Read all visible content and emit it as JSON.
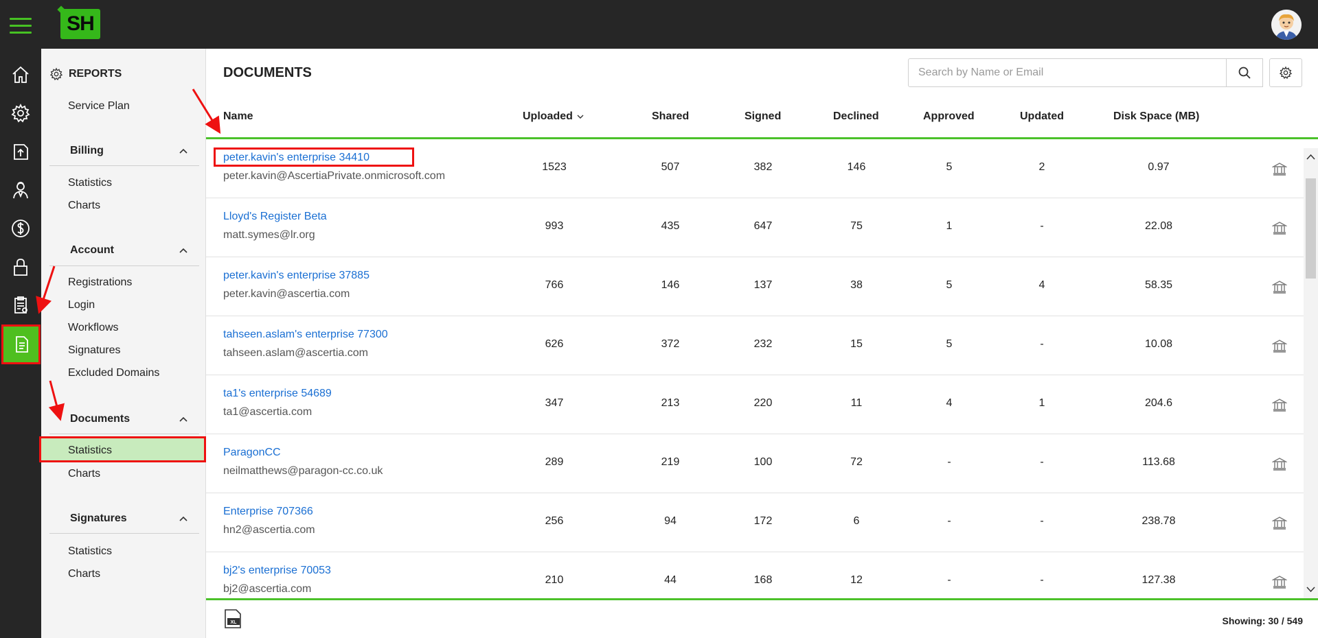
{
  "header": {
    "logo_text": "SH"
  },
  "sidebar": {
    "title": "REPORTS",
    "service_plan": "Service Plan",
    "groups": [
      {
        "label": "Billing",
        "items": [
          "Statistics",
          "Charts"
        ]
      },
      {
        "label": "Account",
        "items": [
          "Registrations",
          "Login",
          "Workflows",
          "Signatures",
          "Excluded Domains"
        ]
      },
      {
        "label": "Documents",
        "items": [
          "Statistics",
          "Charts"
        ]
      },
      {
        "label": "Signatures",
        "items": [
          "Statistics",
          "Charts"
        ]
      }
    ]
  },
  "main": {
    "title": "DOCUMENTS",
    "search_placeholder": "Search by Name or Email",
    "columns": [
      "Name",
      "Uploaded",
      "Shared",
      "Signed",
      "Declined",
      "Approved",
      "Updated",
      "Disk Space (MB)"
    ],
    "rows": [
      {
        "name": "peter.kavin's enterprise 34410",
        "email": "peter.kavin@AscertiaPrivate.onmicrosoft.com",
        "uploaded": "1523",
        "shared": "507",
        "signed": "382",
        "declined": "146",
        "approved": "5",
        "updated": "2",
        "disk": "0.97"
      },
      {
        "name": "Lloyd's Register Beta",
        "email": "matt.symes@lr.org",
        "uploaded": "993",
        "shared": "435",
        "signed": "647",
        "declined": "75",
        "approved": "1",
        "updated": "-",
        "disk": "22.08"
      },
      {
        "name": "peter.kavin's enterprise 37885",
        "email": "peter.kavin@ascertia.com",
        "uploaded": "766",
        "shared": "146",
        "signed": "137",
        "declined": "38",
        "approved": "5",
        "updated": "4",
        "disk": "58.35"
      },
      {
        "name": "tahseen.aslam's enterprise 77300",
        "email": "tahseen.aslam@ascertia.com",
        "uploaded": "626",
        "shared": "372",
        "signed": "232",
        "declined": "15",
        "approved": "5",
        "updated": "-",
        "disk": "10.08"
      },
      {
        "name": "ta1's enterprise 54689",
        "email": "ta1@ascertia.com",
        "uploaded": "347",
        "shared": "213",
        "signed": "220",
        "declined": "11",
        "approved": "4",
        "updated": "1",
        "disk": "204.6"
      },
      {
        "name": "ParagonCC",
        "email": "neilmatthews@paragon-cc.co.uk",
        "uploaded": "289",
        "shared": "219",
        "signed": "100",
        "declined": "72",
        "approved": "-",
        "updated": "-",
        "disk": "113.68"
      },
      {
        "name": "Enterprise 707366",
        "email": "hn2@ascertia.com",
        "uploaded": "256",
        "shared": "94",
        "signed": "172",
        "declined": "6",
        "approved": "-",
        "updated": "-",
        "disk": "238.78"
      },
      {
        "name": "bj2's enterprise 70053",
        "email": "bj2@ascertia.com",
        "uploaded": "210",
        "shared": "44",
        "signed": "168",
        "declined": "12",
        "approved": "-",
        "updated": "-",
        "disk": "127.38"
      }
    ],
    "xl_label": "XL",
    "showing": "Showing: 30 / 549"
  },
  "colors": {
    "accent": "#4bc12a",
    "link": "#1a6fd3",
    "dark": "#262626",
    "highlight": "#ee1111"
  }
}
